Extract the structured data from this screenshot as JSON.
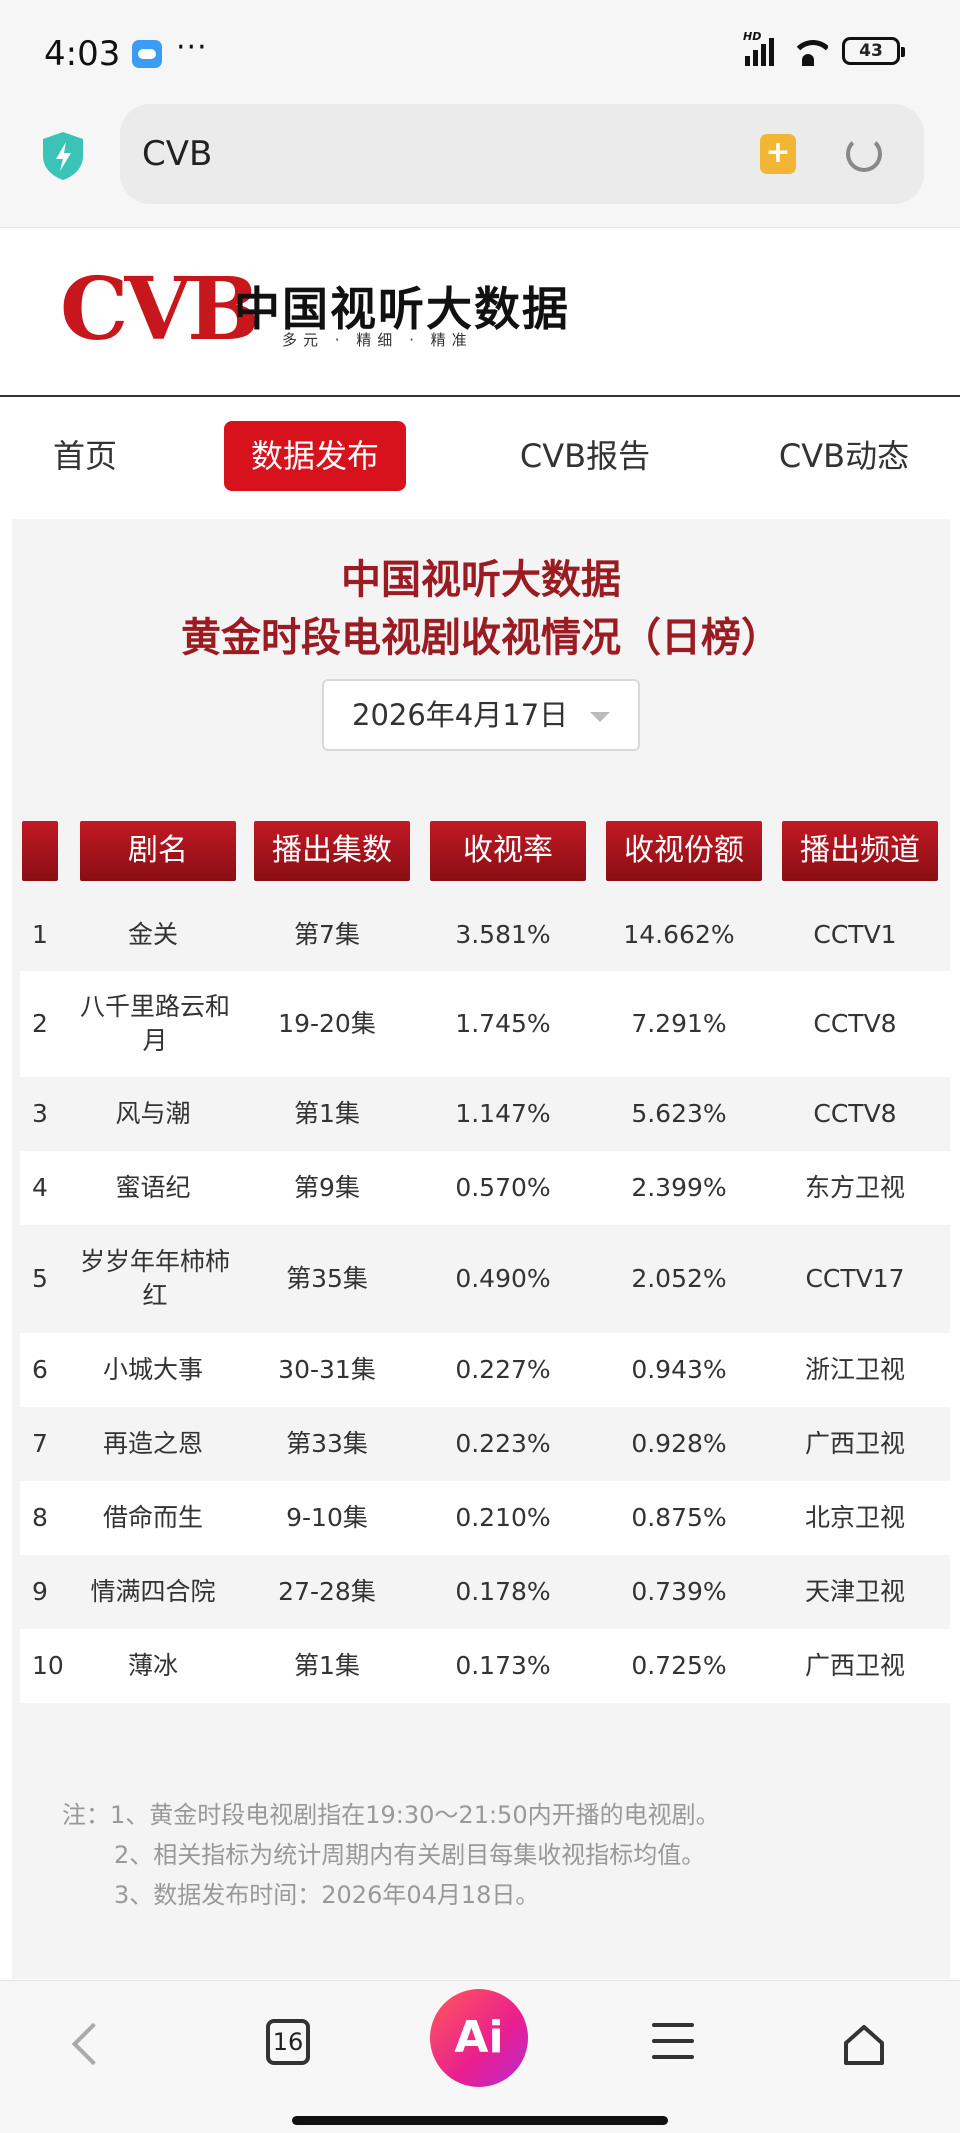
{
  "status_bar": {
    "time": "4:03",
    "dots": "···",
    "signal_label": "HD",
    "battery": "43"
  },
  "browser": {
    "address": "CVB"
  },
  "site": {
    "logo_mark": "CVB",
    "logo_title": "中国视听大数据",
    "slogan": "多元 · 精细 · 精准"
  },
  "nav": [
    {
      "label": "首页"
    },
    {
      "label": "数据发布",
      "active": true
    },
    {
      "label": "CVB报告"
    },
    {
      "label": "CVB动态"
    }
  ],
  "report": {
    "title_line1": "中国视听大数据",
    "title_line2": "黄金时段电视剧收视情况（日榜）",
    "date": "2026年4月17日"
  },
  "table": {
    "headers": [
      "",
      "剧名",
      "播出集数",
      "收视率",
      "收视份额",
      "播出频道"
    ],
    "rows": [
      [
        "1",
        "金关",
        "第7集",
        "3.581%",
        "14.662%",
        "CCTV1"
      ],
      [
        "2",
        "八千里路云和月",
        "19-20集",
        "1.745%",
        "7.291%",
        "CCTV8"
      ],
      [
        "3",
        "风与潮",
        "第1集",
        "1.147%",
        "5.623%",
        "CCTV8"
      ],
      [
        "4",
        "蜜语纪",
        "第9集",
        "0.570%",
        "2.399%",
        "东方卫视"
      ],
      [
        "5",
        "岁岁年年柿柿红",
        "第35集",
        "0.490%",
        "2.052%",
        "CCTV17"
      ],
      [
        "6",
        "小城大事",
        "30-31集",
        "0.227%",
        "0.943%",
        "浙江卫视"
      ],
      [
        "7",
        "再造之恩",
        "第33集",
        "0.223%",
        "0.928%",
        "广西卫视"
      ],
      [
        "8",
        "借命而生",
        "9-10集",
        "0.210%",
        "0.875%",
        "北京卫视"
      ],
      [
        "9",
        "情满四合院",
        "27-28集",
        "0.178%",
        "0.739%",
        "天津卫视"
      ],
      [
        "10",
        "薄冰",
        "第1集",
        "0.173%",
        "0.725%",
        "广西卫视"
      ]
    ]
  },
  "notes": [
    "注：1、黄金时段电视剧指在19:30～21:50内开播的电视剧。",
    "2、相关指标为统计周期内有关剧目每集收视指标均值。",
    "3、数据发布时间：2026年04月18日。"
  ],
  "bottom_bar": {
    "tabs_count": "16",
    "ai_label": "Ai"
  },
  "colors": {
    "brand_red": "#c8161d",
    "title_red": "#9a1b22",
    "nav_active": "#d7121c"
  }
}
